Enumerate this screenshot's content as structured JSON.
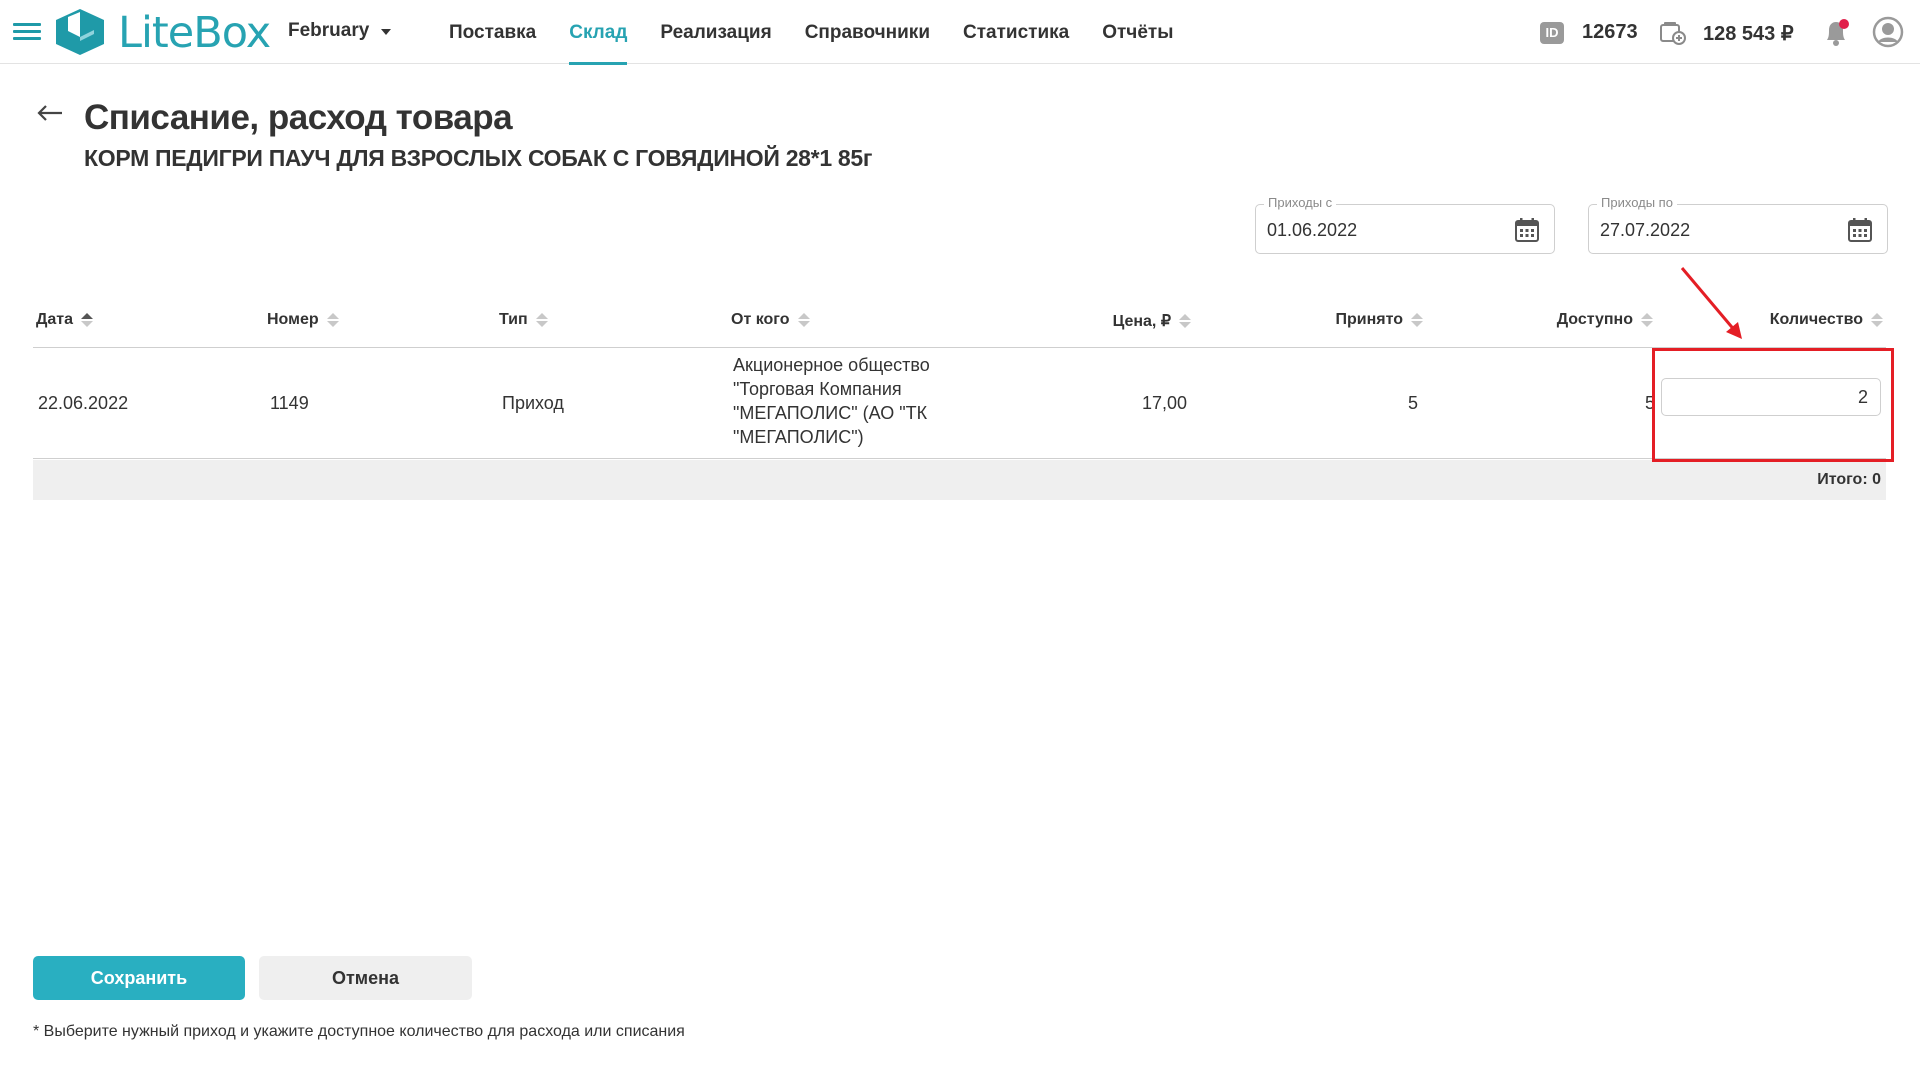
{
  "header": {
    "logo_text": "LiteBox",
    "org_name": "February",
    "nav": [
      {
        "label": "Поставка",
        "active": false
      },
      {
        "label": "Склад",
        "active": true
      },
      {
        "label": "Реализация",
        "active": false
      },
      {
        "label": "Справочники",
        "active": false
      },
      {
        "label": "Статистика",
        "active": false
      },
      {
        "label": "Отчёты",
        "active": false
      }
    ],
    "id_badge": "ID",
    "account_id": "12673",
    "balance": "128 543 ₽",
    "accent_color": "#27a3b2",
    "notification_dot_color": "#e0204a",
    "icons": [
      "menu-icon",
      "logo-cube-icon",
      "id-icon",
      "wallet-icon",
      "bell-icon",
      "user-icon"
    ]
  },
  "page": {
    "title": "Списание, расход товара",
    "subtitle": "КОРМ ПЕДИГРИ ПАУЧ ДЛЯ ВЗРОСЛЫХ СОБАК С ГОВЯДИНОЙ 28*1 85г"
  },
  "filters": {
    "from": {
      "label": "Приходы с",
      "value": "01.06.2022"
    },
    "to": {
      "label": "Приходы по",
      "value": "27.07.2022"
    }
  },
  "table": {
    "columns": [
      "Дата",
      "Номер",
      "Тип",
      "От кого",
      "Цена, ₽",
      "Принято",
      "Доступно",
      "Количество"
    ],
    "rows": [
      {
        "date": "22.06.2022",
        "number": "1149",
        "type": "Приход",
        "supplier_lines": [
          "Акционерное общество",
          "\"Торговая Компания",
          "\"МЕГАПОЛИС\" (АО \"ТК",
          "\"МЕГАПОЛИС\")"
        ],
        "price": "17,00",
        "received": "5",
        "available": "5",
        "quantity": "2"
      }
    ],
    "total": "Итого: 0"
  },
  "actions": {
    "save": "Сохранить",
    "cancel": "Отмена"
  },
  "footnote": "* Выберите нужный приход и укажите доступное количество для расхода или списания",
  "annotation_color": "#e41e25"
}
